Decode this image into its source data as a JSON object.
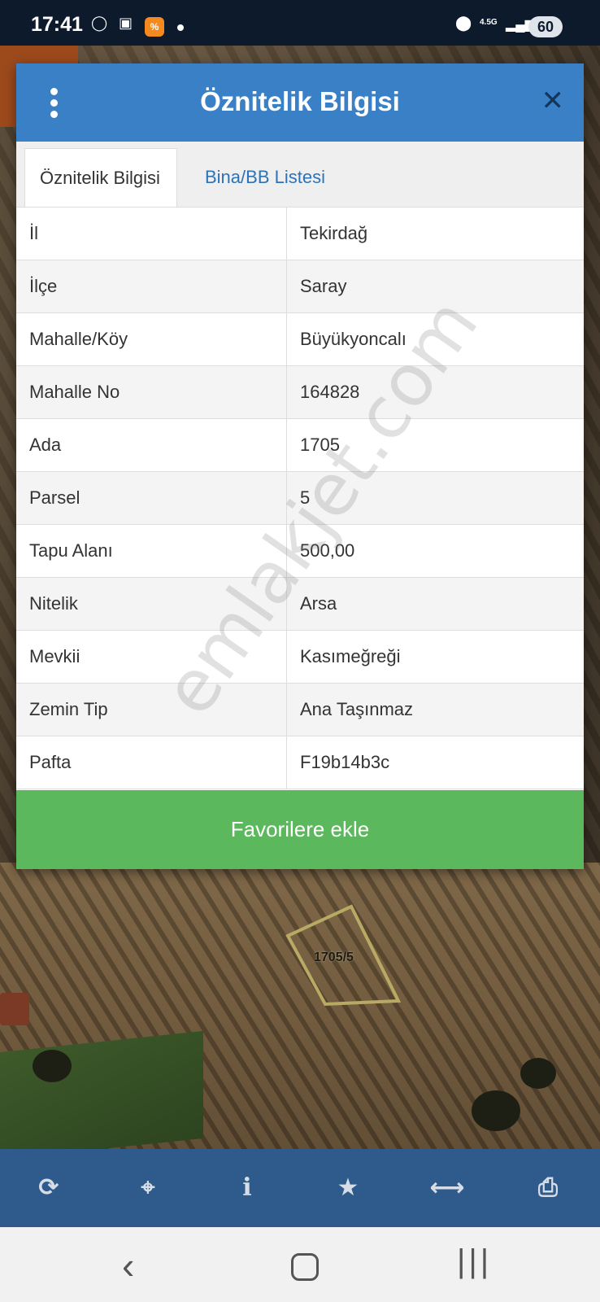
{
  "status_bar": {
    "time": "17:41",
    "network": "4.5G",
    "battery": "60",
    "icons": [
      "whatsapp-icon",
      "scan-icon",
      "app-notification-icon",
      "location-icon",
      "signal-icon"
    ]
  },
  "dialog": {
    "title": "Öznitelik Bilgisi",
    "close_symbol": "✕",
    "tabs": [
      {
        "label": "Öznitelik Bilgisi",
        "active": true
      },
      {
        "label": "Bina/BB Listesi",
        "active": false
      }
    ],
    "rows": [
      {
        "key": "İl",
        "value": "Tekirdağ"
      },
      {
        "key": "İlçe",
        "value": "Saray"
      },
      {
        "key": "Mahalle/Köy",
        "value": "Büyükyoncalı"
      },
      {
        "key": "Mahalle No",
        "value": "164828"
      },
      {
        "key": "Ada",
        "value": "1705"
      },
      {
        "key": "Parsel",
        "value": "5"
      },
      {
        "key": "Tapu Alanı",
        "value": "500,00"
      },
      {
        "key": "Nitelik",
        "value": "Arsa"
      },
      {
        "key": "Mevkii",
        "value": "Kasımeğreği"
      },
      {
        "key": "Zemin Tip",
        "value": "Ana Taşınmaz"
      },
      {
        "key": "Pafta",
        "value": "F19b14b3c"
      }
    ],
    "favorite_button": "Favorilere ekle"
  },
  "watermark": "emlakjet.com",
  "map": {
    "parcel_label": "1705/5"
  },
  "toolbar": {
    "buttons": [
      "refresh-icon",
      "locate-icon",
      "info-icon",
      "star-icon",
      "measure-icon",
      "print-icon"
    ]
  },
  "colors": {
    "header": "#3a80c6",
    "tab_link": "#2c73b8",
    "favorite": "#5cb85c",
    "toolbar": "#2e5a8c"
  }
}
